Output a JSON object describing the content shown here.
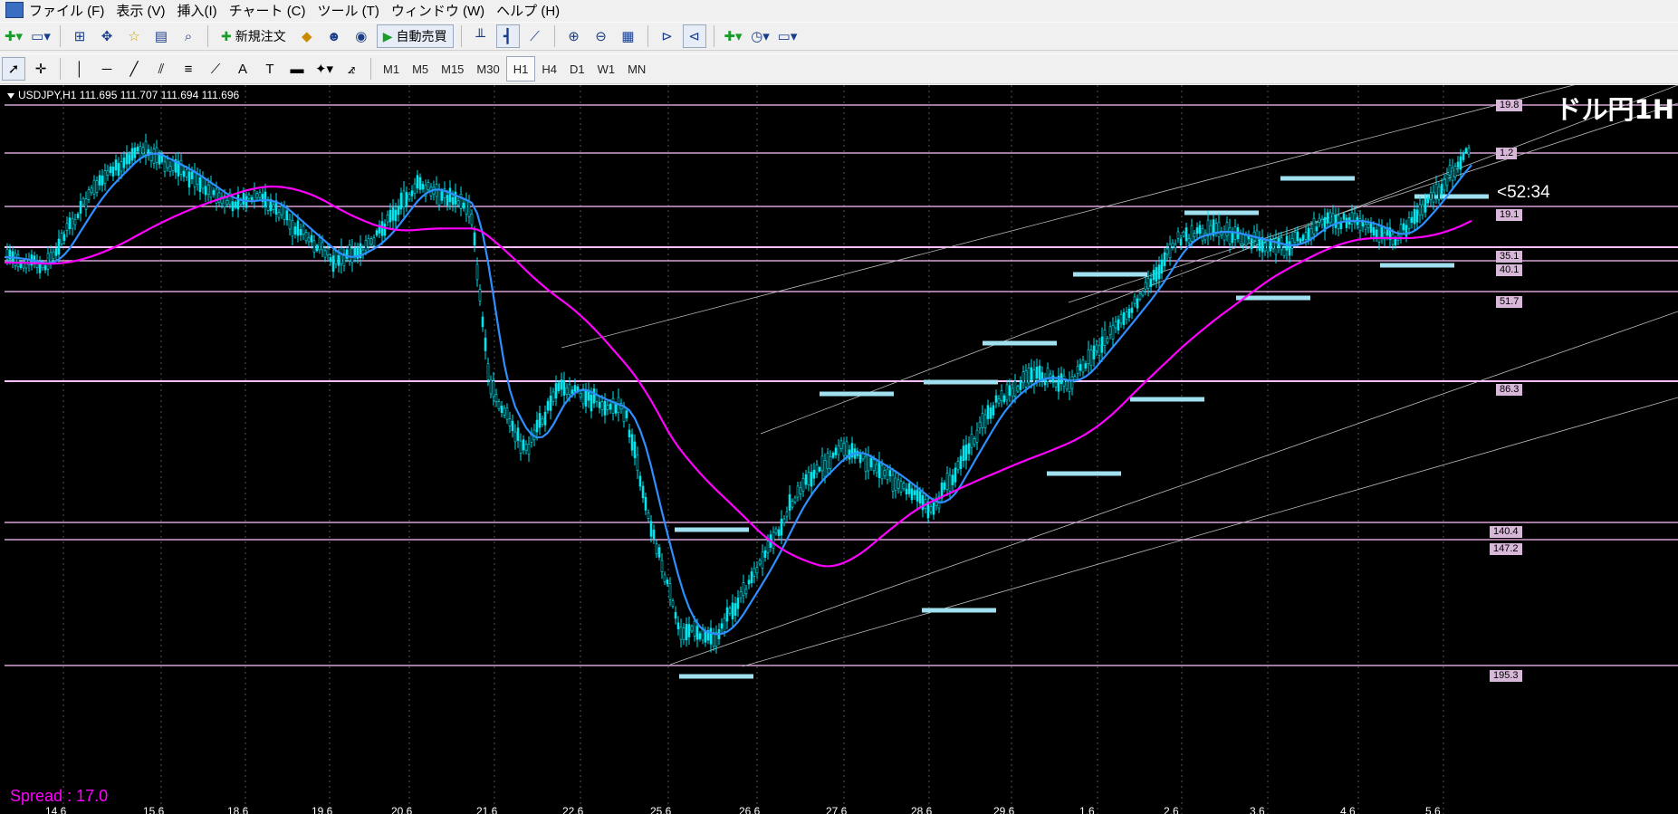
{
  "menubar": {
    "items": [
      "ファイル (F)",
      "表示 (V)",
      "挿入(I)",
      "チャート (C)",
      "ツール (T)",
      "ウィンドウ (W)",
      "ヘルプ (H)"
    ]
  },
  "toolbar1": {
    "new_order": "新規注文",
    "auto_trade": "自動売買"
  },
  "toolbar2": {
    "timeframes": [
      "M1",
      "M5",
      "M15",
      "M30",
      "H1",
      "H4",
      "D1",
      "W1",
      "MN"
    ],
    "active_timeframe": "H1"
  },
  "chart": {
    "info": "USDJPY,H1  111.695 111.707 111.694 111.696",
    "title": "ドル円1H",
    "countdown": "<52:34",
    "spread": "Spread : 17.0",
    "colors": {
      "background": "#000000",
      "candle": "#00e5ee",
      "ma_fast": "#2f8fff",
      "ma_slow": "#ff00ff",
      "level": "#ffc0ff",
      "support": "#a0e0f0"
    },
    "price_labels": [
      "19.8",
      "1.2",
      "19.1",
      "35.1",
      "40.1",
      "51.7",
      "86.3",
      "140.4",
      "147.2",
      "195.3"
    ],
    "date_labels": [
      "14.6",
      "15.6",
      "18.6",
      "19.6",
      "20.6",
      "21.6",
      "22.6",
      "25.6",
      "26.6",
      "27.6",
      "28.6",
      "29.6",
      "1.6",
      "2.6",
      "3.6",
      "4.6",
      "5.6"
    ]
  }
}
